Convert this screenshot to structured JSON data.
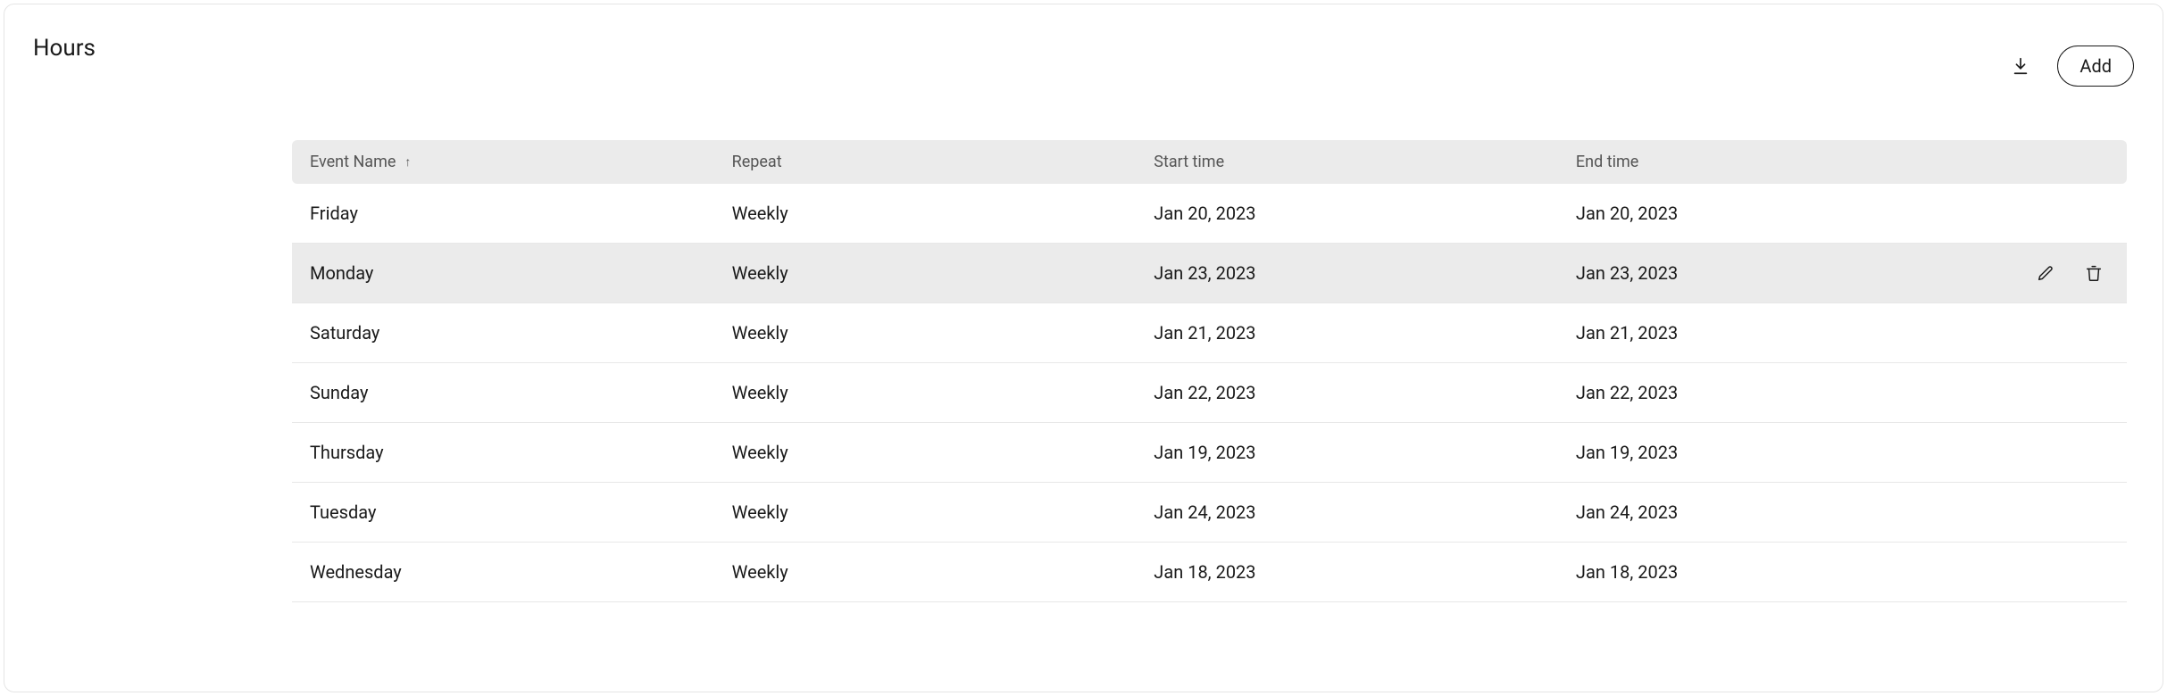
{
  "header": {
    "title": "Hours",
    "add_label": "Add"
  },
  "table": {
    "columns": {
      "event_name": "Event Name",
      "repeat": "Repeat",
      "start_time": "Start time",
      "end_time": "End time"
    },
    "rows": [
      {
        "event": "Friday",
        "repeat": "Weekly",
        "start": "Jan 20, 2023",
        "end": "Jan 20, 2023",
        "highlight": false
      },
      {
        "event": "Monday",
        "repeat": "Weekly",
        "start": "Jan 23, 2023",
        "end": "Jan 23, 2023",
        "highlight": true
      },
      {
        "event": "Saturday",
        "repeat": "Weekly",
        "start": "Jan 21, 2023",
        "end": "Jan 21, 2023",
        "highlight": false
      },
      {
        "event": "Sunday",
        "repeat": "Weekly",
        "start": "Jan 22, 2023",
        "end": "Jan 22, 2023",
        "highlight": false
      },
      {
        "event": "Thursday",
        "repeat": "Weekly",
        "start": "Jan 19, 2023",
        "end": "Jan 19, 2023",
        "highlight": false
      },
      {
        "event": "Tuesday",
        "repeat": "Weekly",
        "start": "Jan 24, 2023",
        "end": "Jan 24, 2023",
        "highlight": false
      },
      {
        "event": "Wednesday",
        "repeat": "Weekly",
        "start": "Jan 18, 2023",
        "end": "Jan 18, 2023",
        "highlight": false
      }
    ]
  }
}
